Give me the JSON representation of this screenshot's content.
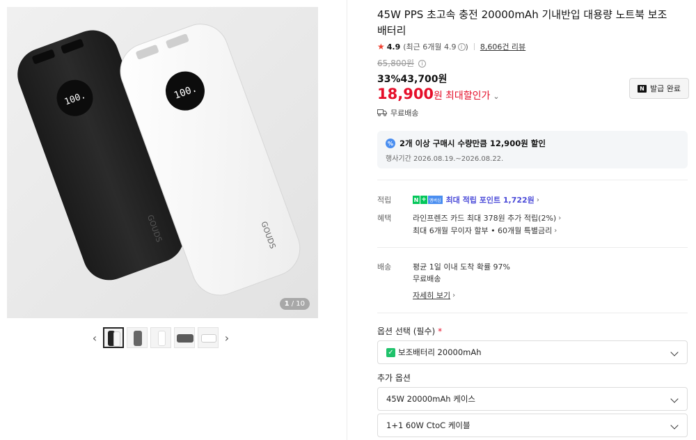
{
  "gallery": {
    "counter_current": "1",
    "counter_total": "/ 10",
    "prev_arrow": "‹",
    "next_arrow": "›",
    "thumbnails": [
      "black power bank",
      "grey power bank",
      "white power bank",
      "grey flat power bank",
      "white case"
    ],
    "product_text_white": "GOUDS",
    "product_text_black": "GOUDS",
    "display_text": "100."
  },
  "product": {
    "title": "45W PPS 초고속 충전 20000mAh 기내반입 대용량 노트북 보조배터리",
    "rating_score": "4.9",
    "rating_recent": "(최근 6개월 4.9",
    "rating_recent_close": ")",
    "review_count": "8,606건 리뷰",
    "original_price": "65,800원",
    "discount_rate": "33%",
    "discount_price": "43,700원",
    "final_price": "18,900",
    "final_unit": "원",
    "final_label": "최대할인가",
    "coupon_label": "발급 완료",
    "shipping": "무료배송"
  },
  "promo": {
    "headline": "2개 이상 구매시 수량만큼 12,900원 할인",
    "period": "행사기간 2026.08.19.~2026.08.22."
  },
  "benefits": {
    "points_label": "적립",
    "points_member": "멤버십",
    "points_value": "최대 적립 포인트 1,722원",
    "benefit_label": "혜택",
    "benefit_1": "라인프렌즈 카드 최대 378원 추가 적립(2%)",
    "benefit_2": "최대 6개월 무이자 할부 • 60개월 특별금리"
  },
  "delivery": {
    "label": "배송",
    "line_1": "평균 1일 이내 도착 확률 97%",
    "line_2": "무료배송",
    "more": "자세히 보기"
  },
  "options": {
    "required_title": "옵션 선택 (필수)",
    "required_mark": "*",
    "required_value": "보조배터리 20000mAh",
    "extra_title": "추가 옵션",
    "extra_1": "45W 20000mAh 케이스",
    "extra_2": "1+1 60W CtoC 케이블"
  },
  "colors": {
    "accent_red": "#e50f2a",
    "naver_green": "#03c75a",
    "points_purple": "#4a4ad8"
  }
}
